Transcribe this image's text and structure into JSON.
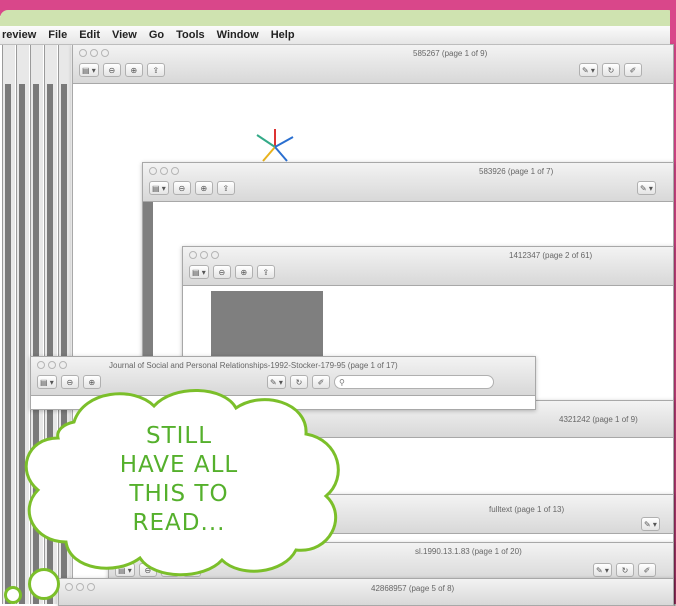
{
  "menubar": {
    "app": "review",
    "items": [
      "File",
      "Edit",
      "View",
      "Go",
      "Tools",
      "Window",
      "Help"
    ]
  },
  "windows": [
    {
      "id": "w1",
      "title": "585267 (page 1 of 9)"
    },
    {
      "id": "w2",
      "title": "583926 (page 1 of 7)"
    },
    {
      "id": "w3",
      "title": "1412347 (page 2 of 61)"
    },
    {
      "id": "w4",
      "title": "Journal of Social and Personal Relationships-1992-Stocker-179-95 (page 1 of 17)"
    },
    {
      "id": "w5",
      "title": "4321242 (page 1 of 9)"
    },
    {
      "id": "w6",
      "title": "fulltext (page 1 of 13)"
    },
    {
      "id": "w7",
      "title": "sl.1990.13.1.83 (page 1 of 20)"
    },
    {
      "id": "w8",
      "title": "42868957 (page 5 of 8)"
    }
  ],
  "toolbar": {
    "sidebar_btn": "▤ ▾",
    "zoom_out": "⊖",
    "zoom_in": "⊕",
    "share": "⇪",
    "annotate": "✎ ▾",
    "rotate": "↻",
    "edit": "✐"
  },
  "callout": {
    "lines": [
      "STILL",
      "HAVE ALL",
      "THIS TO",
      "READ..."
    ]
  },
  "colors": {
    "callout_green": "#7bbf2a",
    "text_green": "#55b02c",
    "frame_pink": "#d9478a",
    "strip_green": "#cfe3b0"
  }
}
